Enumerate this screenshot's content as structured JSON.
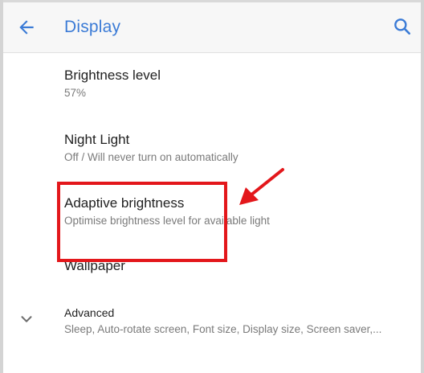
{
  "appbar": {
    "title": "Display",
    "back_icon": "arrow-left-icon",
    "search_icon": "search-icon",
    "accent_color": "#3b7bd6"
  },
  "settings": [
    {
      "id": "brightness",
      "title": "Brightness level",
      "subtitle": "57%"
    },
    {
      "id": "night-light",
      "title": "Night Light",
      "subtitle": "Off / Will never turn on automatically"
    },
    {
      "id": "adaptive",
      "title": "Adaptive brightness",
      "subtitle": "Optimise brightness level for available light"
    },
    {
      "id": "wallpaper",
      "title": "Wallpaper"
    },
    {
      "id": "advanced",
      "title": "Advanced",
      "subtitle": "Sleep, Auto-rotate screen, Font size, Display size, Screen saver,...",
      "icon": "chevron-down-icon"
    }
  ],
  "annotation": {
    "color": "#e3171b",
    "highlight_target": "Adaptive brightness",
    "arrow_icon": "arrow-pointer-icon"
  }
}
